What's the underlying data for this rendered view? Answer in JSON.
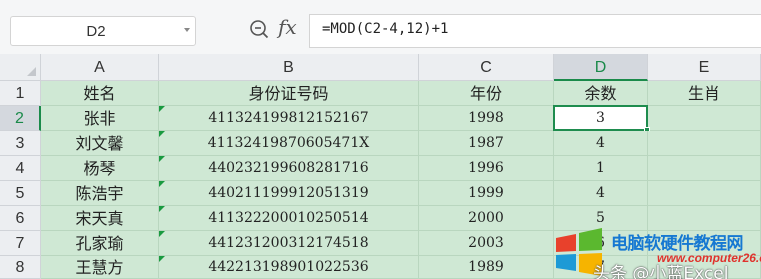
{
  "formula_bar": {
    "name_box": "D2",
    "fx_symbol": "fx",
    "formula": "=MOD(C2-4,12)+1"
  },
  "columns": [
    "A",
    "B",
    "C",
    "D",
    "E"
  ],
  "selected_column": "D",
  "rows": [
    {
      "row_num": "1",
      "cells": [
        "姓名",
        "身份证号码",
        "年份",
        "余数",
        "生肖"
      ]
    },
    {
      "row_num": "2",
      "cells": [
        "张非",
        "41132419981215216​7",
        "1998",
        "3",
        ""
      ]
    },
    {
      "row_num": "3",
      "cells": [
        "刘文馨",
        "41132419870605471X",
        "1987",
        "4",
        ""
      ]
    },
    {
      "row_num": "4",
      "cells": [
        "杨琴",
        "440232199608281716",
        "1996",
        "1",
        ""
      ]
    },
    {
      "row_num": "5",
      "cells": [
        "陈浩宇",
        "440211199912051319",
        "1999",
        "4",
        ""
      ]
    },
    {
      "row_num": "6",
      "cells": [
        "宋天真",
        "411322200010250514",
        "2000",
        "5",
        ""
      ]
    },
    {
      "row_num": "7",
      "cells": [
        "孔家瑜",
        "441231200312174518",
        "2003",
        "6",
        ""
      ]
    },
    {
      "row_num": "8",
      "cells": [
        "王慧方",
        "442213198901022536",
        "1989",
        "7",
        ""
      ]
    }
  ],
  "selected_cell": "D2",
  "colors": {
    "cell_fill": "#cfe8d4",
    "selection": "#1e8c4e",
    "header_bg": "#eceef1",
    "number_error_marker": "#1a9a40"
  },
  "watermark": {
    "site_name": "电脑软硬件教程网",
    "url": "www.computer26.com",
    "author": "头条 @小蓝Excel"
  }
}
